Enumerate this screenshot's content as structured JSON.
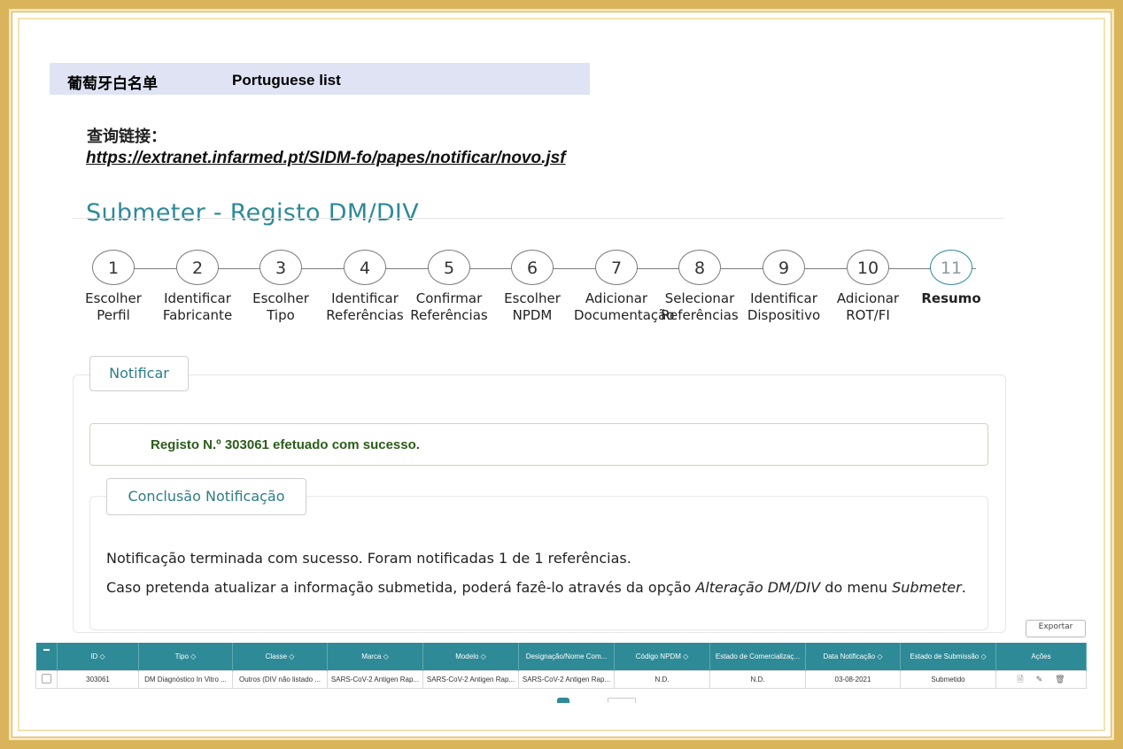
{
  "header": {
    "title_cn": "葡萄牙白名单",
    "title_en": "Portuguese list"
  },
  "query": {
    "label": "查询链接：",
    "url": "https://extranet.infarmed.pt/SIDM-fo/papes/notificar/novo.jsf"
  },
  "page_title": "Submeter - Registo DM/DIV",
  "steps": [
    {
      "num": "1",
      "label": "Escolher\nPerfil"
    },
    {
      "num": "2",
      "label": "Identificar\nFabricante"
    },
    {
      "num": "3",
      "label": "Escolher\nTipo"
    },
    {
      "num": "4",
      "label": "Identificar\nReferências"
    },
    {
      "num": "5",
      "label": "Confirmar\nReferências"
    },
    {
      "num": "6",
      "label": "Escolher\nNPDM"
    },
    {
      "num": "7",
      "label": "Adicionar\nDocumentação"
    },
    {
      "num": "8",
      "label": "Selecionar\nReferências"
    },
    {
      "num": "9",
      "label": "Identificar\nDispositivo"
    },
    {
      "num": "10",
      "label": "Adicionar\nROT/FI"
    },
    {
      "num": "11",
      "label": "Resumo"
    }
  ],
  "notificar": {
    "tab_label": "Notificar",
    "success_message": "Registo N.º 303061 efetuado com sucesso.",
    "conclusion_tab": "Conclusão Notificação",
    "paragraph1": "Notificação terminada com sucesso. Foram notificadas 1 de 1 referências.",
    "paragraph2_a": "Caso pretenda atualizar a informação submetida, poderá fazê-lo através da opção ",
    "paragraph2_em1": "Alteração DM/DIV",
    "paragraph2_b": " do menu ",
    "paragraph2_em2": "Submeter",
    "paragraph2_c": "."
  },
  "table": {
    "export_label": "Exportar",
    "columns": [
      "ID ◇",
      "Tipo ◇",
      "Classe ◇",
      "Marca ◇",
      "Modelo ◇",
      "Designação/Nome Com...",
      "Código NPDM ◇",
      "Estado de Comercializaç...",
      "Data Notificação ◇",
      "Estado de Submissão ◇",
      "Ações"
    ],
    "rows": [
      [
        "303061",
        "DM Diagnóstico In Vitro ...",
        "Outros (DIV não listado ...",
        "SARS-CoV-2 Antigen Rap...",
        "SARS-CoV-2 Antigen Rap...",
        "SARS-CoV-2 Antigen Rap...",
        "N.D.",
        "N.D.",
        "03-08-2021",
        "Submetido"
      ]
    ],
    "action_icons": [
      "document-icon",
      "edit-icon",
      "trash-icon"
    ]
  },
  "colors": {
    "accent": "#2e8a97",
    "success_text": "#2b5d1a",
    "frame": "#d9b45a",
    "header_band": "#dfe3f4"
  }
}
